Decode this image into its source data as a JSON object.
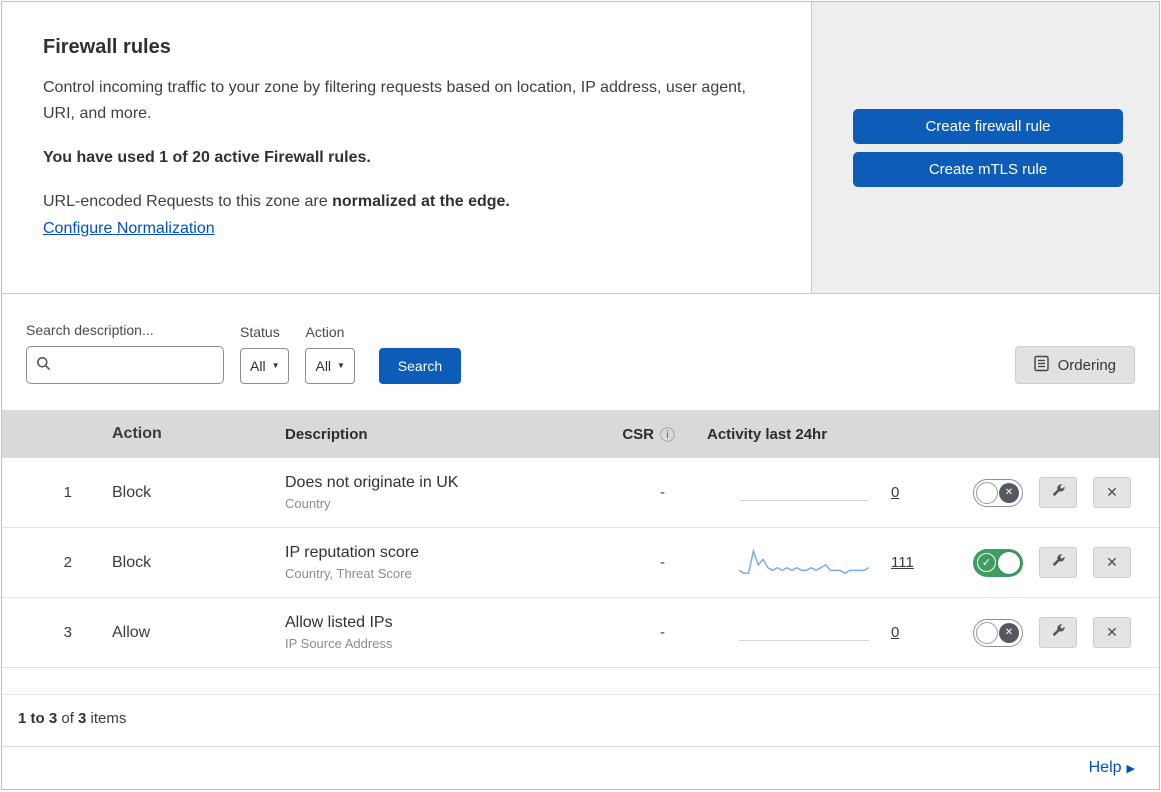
{
  "header": {
    "title": "Firewall rules",
    "description": "Control incoming traffic to your zone by filtering requests based on location, IP address, user agent, URI, and more.",
    "usage": "You have used 1 of 20 active Firewall rules.",
    "normalization": {
      "prefix": "URL-encoded Requests to this zone are ",
      "bold": "normalized at the edge.",
      "link": "Configure Normalization"
    },
    "actions": {
      "create_firewall_rule": "Create firewall rule",
      "create_mtls_rule": "Create mTLS rule"
    }
  },
  "filters": {
    "search_label": "Search description...",
    "status": {
      "label": "Status",
      "value": "All"
    },
    "action": {
      "label": "Action",
      "value": "All"
    },
    "search_button": "Search",
    "ordering_button": "Ordering"
  },
  "table": {
    "headers": {
      "action": "Action",
      "description": "Description",
      "csr": "CSR",
      "activity": "Activity last 24hr"
    },
    "rows": [
      {
        "priority": "1",
        "action": "Block",
        "description": "Does not originate in UK",
        "rule_fields": "Country",
        "csr": "-",
        "activity_count": "0",
        "enabled": false
      },
      {
        "priority": "2",
        "action": "Block",
        "description": "IP reputation score",
        "rule_fields": "Country, Threat Score",
        "csr": "-",
        "activity_count": "111",
        "enabled": true,
        "sparkline": [
          2,
          1,
          1,
          9,
          4,
          6,
          3,
          2,
          3,
          2,
          3,
          2,
          3,
          2,
          2,
          3,
          2,
          3,
          4,
          2,
          2,
          2,
          1,
          2,
          2,
          2,
          2,
          3
        ]
      },
      {
        "priority": "3",
        "action": "Allow",
        "description": "Allow listed IPs",
        "rule_fields": "IP Source Address",
        "csr": "-",
        "activity_count": "0",
        "enabled": false
      }
    ],
    "summary": {
      "range": "1 to 3",
      "of": " of ",
      "total": "3",
      "items": " items"
    }
  },
  "help_link": "Help",
  "icons": {
    "caret_down": "▼",
    "info": "ⓘ",
    "check": "✓",
    "x": "✕",
    "close": "✕",
    "help_arrow": "▶"
  },
  "colors": {
    "primary_blue": "#0d5cb8",
    "link_blue": "#0051c3",
    "toggle_on_green": "#3f9d63",
    "sparkline_blue": "#7aaede"
  }
}
